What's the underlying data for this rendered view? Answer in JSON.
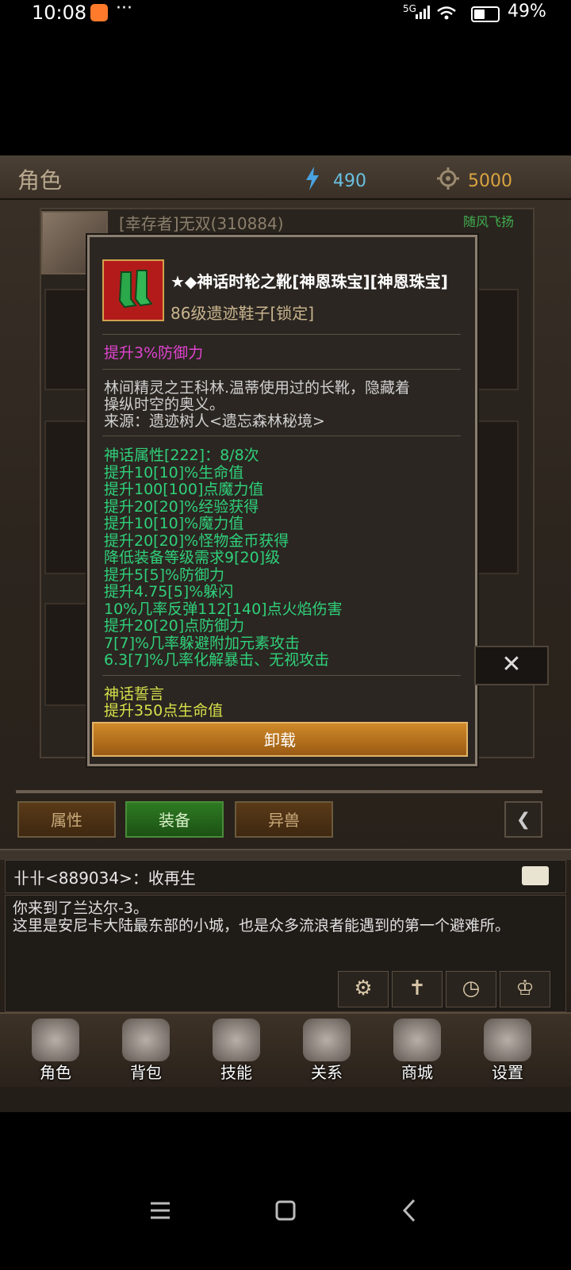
{
  "status_bar": {
    "time": "10:08",
    "more": "···",
    "network": "5G",
    "battery": "49%"
  },
  "topbar": {
    "title": "角色",
    "gems": "490",
    "gold": "5000"
  },
  "character": {
    "name": "[幸存者]无双(310884)",
    "guild": "随风飞扬"
  },
  "tooltip": {
    "item_name": "★◆神话时轮之靴[神恩珠宝][神恩珠宝]",
    "item_subtitle": "86级遗迹鞋子[锁定]",
    "base_attr": "提升3%防御力",
    "description": [
      "林间精灵之王科林.温蒂使用过的长靴，隐藏着",
      "操纵时空的奥义。",
      "来源：遗迹树人<遗忘森林秘境>"
    ],
    "myth_attrs": [
      "神话属性[222]：8/8次",
      "提升10[10]%生命值",
      "提升100[100]点魔力值",
      "提升20[20]%经验获得",
      "提升10[10]%魔力值",
      "提升20[20]%怪物金币获得",
      "降低装备等级需求9[20]级",
      "提升5[5]%防御力",
      "提升4.75[5]%躲闪",
      "10%几率反弹112[140]点火焰伤害",
      "提升20[20]点防御力",
      "7[7]%几率躲避附加元素攻击",
      "6.3[7]%几率化解暴击、无视攻击"
    ],
    "oath_title": "神话誓言",
    "oath_attr": "提升350点生命值",
    "unload_label": "卸载",
    "close_label": "✕"
  },
  "tabs": [
    {
      "label": "属性",
      "active": false
    },
    {
      "label": "装备",
      "active": true
    },
    {
      "label": "异兽",
      "active": false
    }
  ],
  "chat": {
    "latest": "卝卝<889034>：收再生",
    "message": "你来到了兰达尔-3。\n这里是安尼卡大陆最东部的小城，也是众多流浪者能遇到的第一个避难所。"
  },
  "quick_icons": [
    "gear-icon",
    "weapon-icon",
    "clock-icon",
    "trophy-icon"
  ],
  "bottom_nav": [
    {
      "label": "角色",
      "icon": "helmet-icon"
    },
    {
      "label": "背包",
      "icon": "bag-icon"
    },
    {
      "label": "技能",
      "icon": "skill-book-icon"
    },
    {
      "label": "关系",
      "icon": "handshake-icon"
    },
    {
      "label": "商城",
      "icon": "chest-icon"
    },
    {
      "label": "设置",
      "icon": "settings-gear-icon"
    }
  ]
}
